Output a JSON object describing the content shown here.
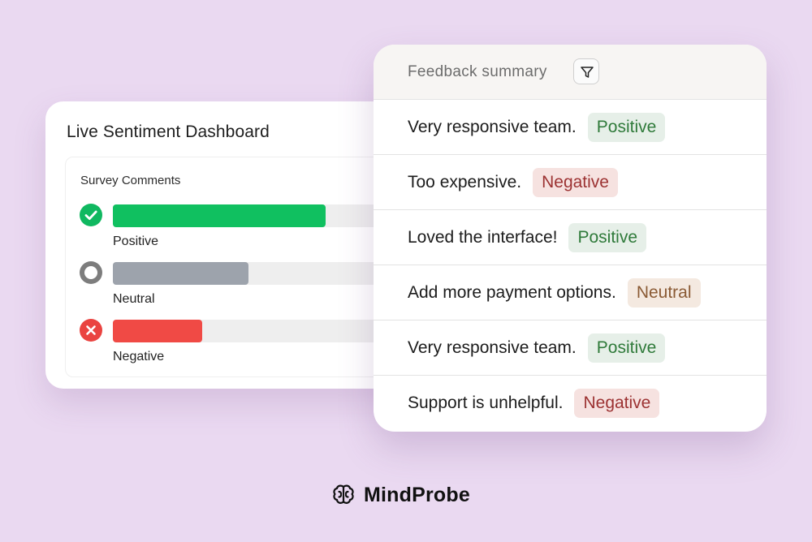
{
  "dashboard": {
    "title": "Live Sentiment Dashboard",
    "section_label": "Survey Comments",
    "bars": [
      {
        "label": "Positive",
        "fraction": 0.69,
        "color": "#10c060",
        "track": "#eeeeee",
        "icon_color": "#10b860",
        "icon": "check-circle-icon"
      },
      {
        "label": "Neutral",
        "fraction": 0.44,
        "color": "#9da3ac",
        "track": "#eeeeee",
        "icon_color": "#7d7d7d",
        "icon": "ring-circle-icon"
      },
      {
        "label": "Negative",
        "fraction": 0.29,
        "color": "#f04a45",
        "track": "#eeeeee",
        "icon_color": "#ea4340",
        "icon": "x-circle-icon"
      }
    ]
  },
  "feedback": {
    "header_title": "Feedback summary",
    "filter_icon": "filter-icon",
    "rows": [
      {
        "text": "Very responsive team.",
        "tag": "Positive"
      },
      {
        "text": "Too expensive.",
        "tag": "Negative"
      },
      {
        "text": "Loved the interface!",
        "tag": "Positive"
      },
      {
        "text": "Add more payment options.",
        "tag": "Neutral"
      },
      {
        "text": "Very responsive team.",
        "tag": "Positive"
      },
      {
        "text": "Support is unhelpful.",
        "tag": "Negative"
      }
    ]
  },
  "tag_colors": {
    "Positive": {
      "bg": "#e6efe8",
      "fg": "#2f7a3a"
    },
    "Negative": {
      "bg": "#f6e2e0",
      "fg": "#9c3232"
    },
    "Neutral": {
      "bg": "#f4e9e0",
      "fg": "#8a5a34"
    }
  },
  "brand": {
    "name": "MindProbe",
    "logo_icon": "brain-icon"
  },
  "colors": {
    "background": "#ead9f1",
    "card": "#ffffff"
  }
}
